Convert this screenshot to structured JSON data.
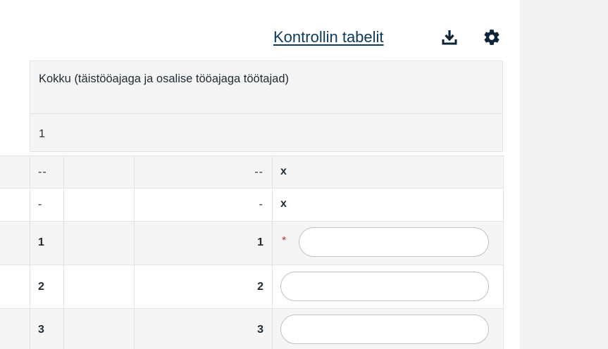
{
  "toolbar": {
    "control_link_label": "Kontrollin tabelit",
    "download_icon": "download-icon",
    "settings_icon": "gear-icon"
  },
  "table": {
    "header": "Kokku (täistööajaga ja osalise tööajaga töötajad)",
    "subheader": "1",
    "rows": [
      {
        "left": "--",
        "right": "--",
        "value_mark": "x"
      },
      {
        "left": "-",
        "right": "-",
        "value_mark": "x"
      },
      {
        "left": "1",
        "right": "1",
        "required_mark": "*",
        "input_value": ""
      },
      {
        "left": "2",
        "right": "2",
        "input_value": ""
      },
      {
        "left": "3",
        "right": "3",
        "input_value": ""
      }
    ]
  },
  "colors": {
    "link": "#0d3a5c",
    "required": "#c0392b",
    "panel": "#f3f3f3",
    "header_bg": "#f5f5f5",
    "border": "#e4e4e4"
  }
}
